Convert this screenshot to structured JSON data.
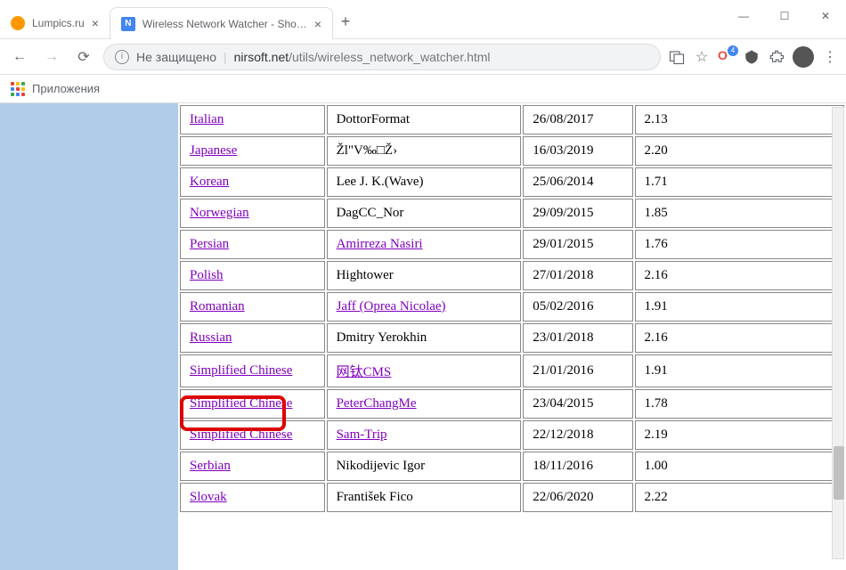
{
  "window": {
    "tabs": [
      {
        "title": "Lumpics.ru",
        "active": false
      },
      {
        "title": "Wireless Network Watcher - Sho…",
        "active": true
      }
    ]
  },
  "address": {
    "not_secure": "Не защищено",
    "host": "nirsoft.net",
    "path": "/utils/wireless_network_watcher.html"
  },
  "bookmarks": {
    "apps": "Приложения"
  },
  "extensions": {
    "badge": "4"
  },
  "rows": [
    {
      "lang": "Italian",
      "author": "DottorFormat",
      "author_link": false,
      "date": "26/08/2017",
      "ver": "2.13"
    },
    {
      "lang": "Japanese",
      "author": "Žl\"V‰□Ž›",
      "author_link": false,
      "date": "16/03/2019",
      "ver": "2.20"
    },
    {
      "lang": "Korean",
      "author": "Lee J. K.(Wave)",
      "author_link": false,
      "date": "25/06/2014",
      "ver": "1.71"
    },
    {
      "lang": "Norwegian",
      "author": "DagCC_Nor",
      "author_link": false,
      "date": "29/09/2015",
      "ver": "1.85"
    },
    {
      "lang": "Persian",
      "author": "Amirreza Nasiri",
      "author_link": true,
      "date": "29/01/2015",
      "ver": "1.76"
    },
    {
      "lang": "Polish",
      "author": "Hightower",
      "author_link": false,
      "date": "27/01/2018",
      "ver": "2.16"
    },
    {
      "lang": "Romanian",
      "author": "Jaff (Oprea Nicolae)",
      "author_link": true,
      "date": "05/02/2016",
      "ver": "1.91"
    },
    {
      "lang": "Russian",
      "author": "Dmitry Yerokhin",
      "author_link": false,
      "date": "23/01/2018",
      "ver": "2.16"
    },
    {
      "lang": "Simplified Chinese",
      "author": "网钛CMS",
      "author_link": true,
      "date": "21/01/2016",
      "ver": "1.91"
    },
    {
      "lang": "Simplified Chinese",
      "author": "PeterChangMe",
      "author_link": true,
      "date": "23/04/2015",
      "ver": "1.78"
    },
    {
      "lang": "Simplified Chinese",
      "author": "Sam-Trip",
      "author_link": true,
      "date": "22/12/2018",
      "ver": "2.19"
    },
    {
      "lang": "Serbian",
      "author": "Nikodijevic Igor",
      "author_link": false,
      "date": "18/11/2016",
      "ver": "1.00"
    },
    {
      "lang": "Slovak",
      "author": "František Fico",
      "author_link": false,
      "date": "22/06/2020",
      "ver": "2.22"
    }
  ],
  "apps_colors": [
    "#ea4335",
    "#fbbc05",
    "#34a853",
    "#4285f4",
    "#ea4335",
    "#fbbc05",
    "#34a853",
    "#4285f4",
    "#ea4335"
  ]
}
